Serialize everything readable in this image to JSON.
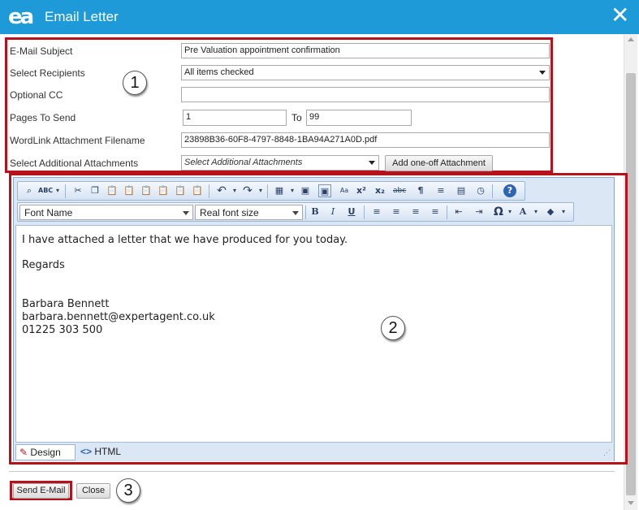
{
  "window": {
    "logo": "ea",
    "title": "Email Letter",
    "close": "✕"
  },
  "form": {
    "subject_label": "E-Mail Subject",
    "subject_value": "Pre Valuation appointment confirmation",
    "recipients_label": "Select Recipients",
    "recipients_value": "All items checked",
    "cc_label": "Optional CC",
    "cc_value": "",
    "pages_label": "Pages To Send",
    "pages_from": "1",
    "pages_to_label": "To",
    "pages_to": "99",
    "filename_label": "WordLink Attachment Filename",
    "filename_value": "23898B36-60F8-4797-8848-1BA94A271A0D.pdf",
    "attachments_label": "Select Additional Attachments",
    "attachments_placeholder": "Select Additional Attachments",
    "oneoff_button": "Add one-off Attachment"
  },
  "editor": {
    "font_name": "Font Name",
    "font_size": "Real font size",
    "body": {
      "line1": "I have attached a letter that we have produced for you today.",
      "line2": "Regards",
      "line3": "Barbara Bennett",
      "line4": "barbara.bennett@expertagent.co.uk",
      "line5": "01225 303 500"
    },
    "mode_design": "Design",
    "mode_html": "HTML"
  },
  "callouts": {
    "c1": "1",
    "c2": "2",
    "c3": "3"
  },
  "footer": {
    "send_button": "Send E-Mail",
    "close_button": "Close"
  },
  "colors": {
    "titlebar": "#1e9ad8",
    "highlight": "#b5121b",
    "editor_bg": "#dbe7f5"
  },
  "icons": [
    "find-replace-icon",
    "spellcheck-icon",
    "cut-icon",
    "copy-icon",
    "paste-icon",
    "paste-plain-icon",
    "paste-word-icon",
    "paste-html-icon",
    "paste-clean-icon",
    "undo-icon",
    "redo-icon",
    "table-icon",
    "image-icon",
    "image-manager-icon",
    "document-icon",
    "superscript-icon",
    "subscript-icon",
    "strikethrough-icon",
    "paragraph-icon",
    "align-icon",
    "form-icon",
    "clock-icon",
    "help-icon"
  ]
}
